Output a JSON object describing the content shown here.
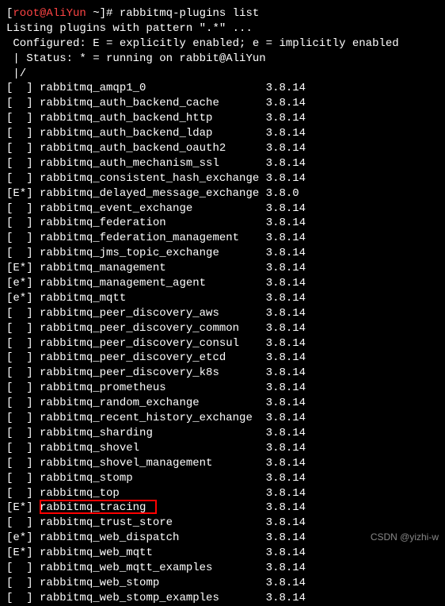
{
  "prompt": {
    "user_host": "root@AliYun",
    "path": "~",
    "command": "rabbitmq-plugins list"
  },
  "header": {
    "line1": "Listing plugins with pattern \".*\" ...",
    "line2": " Configured: E = explicitly enabled; e = implicitly enabled",
    "line3": " | Status: * = running on rabbit@AliYun",
    "line4": " |/"
  },
  "plugins": [
    {
      "flags": "[  ]",
      "name": "rabbitmq_amqp1_0",
      "version": "3.8.14",
      "highlighted": false
    },
    {
      "flags": "[  ]",
      "name": "rabbitmq_auth_backend_cache",
      "version": "3.8.14",
      "highlighted": false
    },
    {
      "flags": "[  ]",
      "name": "rabbitmq_auth_backend_http",
      "version": "3.8.14",
      "highlighted": false
    },
    {
      "flags": "[  ]",
      "name": "rabbitmq_auth_backend_ldap",
      "version": "3.8.14",
      "highlighted": false
    },
    {
      "flags": "[  ]",
      "name": "rabbitmq_auth_backend_oauth2",
      "version": "3.8.14",
      "highlighted": false
    },
    {
      "flags": "[  ]",
      "name": "rabbitmq_auth_mechanism_ssl",
      "version": "3.8.14",
      "highlighted": false
    },
    {
      "flags": "[  ]",
      "name": "rabbitmq_consistent_hash_exchange",
      "version": "3.8.14",
      "highlighted": false
    },
    {
      "flags": "[E*]",
      "name": "rabbitmq_delayed_message_exchange",
      "version": "3.8.0",
      "highlighted": false
    },
    {
      "flags": "[  ]",
      "name": "rabbitmq_event_exchange",
      "version": "3.8.14",
      "highlighted": false
    },
    {
      "flags": "[  ]",
      "name": "rabbitmq_federation",
      "version": "3.8.14",
      "highlighted": false
    },
    {
      "flags": "[  ]",
      "name": "rabbitmq_federation_management",
      "version": "3.8.14",
      "highlighted": false
    },
    {
      "flags": "[  ]",
      "name": "rabbitmq_jms_topic_exchange",
      "version": "3.8.14",
      "highlighted": false
    },
    {
      "flags": "[E*]",
      "name": "rabbitmq_management",
      "version": "3.8.14",
      "highlighted": false
    },
    {
      "flags": "[e*]",
      "name": "rabbitmq_management_agent",
      "version": "3.8.14",
      "highlighted": false
    },
    {
      "flags": "[e*]",
      "name": "rabbitmq_mqtt",
      "version": "3.8.14",
      "highlighted": false
    },
    {
      "flags": "[  ]",
      "name": "rabbitmq_peer_discovery_aws",
      "version": "3.8.14",
      "highlighted": false
    },
    {
      "flags": "[  ]",
      "name": "rabbitmq_peer_discovery_common",
      "version": "3.8.14",
      "highlighted": false
    },
    {
      "flags": "[  ]",
      "name": "rabbitmq_peer_discovery_consul",
      "version": "3.8.14",
      "highlighted": false
    },
    {
      "flags": "[  ]",
      "name": "rabbitmq_peer_discovery_etcd",
      "version": "3.8.14",
      "highlighted": false
    },
    {
      "flags": "[  ]",
      "name": "rabbitmq_peer_discovery_k8s",
      "version": "3.8.14",
      "highlighted": false
    },
    {
      "flags": "[  ]",
      "name": "rabbitmq_prometheus",
      "version": "3.8.14",
      "highlighted": false
    },
    {
      "flags": "[  ]",
      "name": "rabbitmq_random_exchange",
      "version": "3.8.14",
      "highlighted": false
    },
    {
      "flags": "[  ]",
      "name": "rabbitmq_recent_history_exchange",
      "version": "3.8.14",
      "highlighted": false
    },
    {
      "flags": "[  ]",
      "name": "rabbitmq_sharding",
      "version": "3.8.14",
      "highlighted": false
    },
    {
      "flags": "[  ]",
      "name": "rabbitmq_shovel",
      "version": "3.8.14",
      "highlighted": false
    },
    {
      "flags": "[  ]",
      "name": "rabbitmq_shovel_management",
      "version": "3.8.14",
      "highlighted": false
    },
    {
      "flags": "[  ]",
      "name": "rabbitmq_stomp",
      "version": "3.8.14",
      "highlighted": false
    },
    {
      "flags": "[  ]",
      "name": "rabbitmq_top",
      "version": "3.8.14",
      "highlighted": false
    },
    {
      "flags": "[E*]",
      "name": "rabbitmq_tracing",
      "version": "3.8.14",
      "highlighted": true
    },
    {
      "flags": "[  ]",
      "name": "rabbitmq_trust_store",
      "version": "3.8.14",
      "highlighted": false
    },
    {
      "flags": "[e*]",
      "name": "rabbitmq_web_dispatch",
      "version": "3.8.14",
      "highlighted": false
    },
    {
      "flags": "[E*]",
      "name": "rabbitmq_web_mqtt",
      "version": "3.8.14",
      "highlighted": false
    },
    {
      "flags": "[  ]",
      "name": "rabbitmq_web_mqtt_examples",
      "version": "3.8.14",
      "highlighted": false
    },
    {
      "flags": "[  ]",
      "name": "rabbitmq_web_stomp",
      "version": "3.8.14",
      "highlighted": false
    },
    {
      "flags": "[  ]",
      "name": "rabbitmq_web_stomp_examples",
      "version": "3.8.14",
      "highlighted": false
    }
  ],
  "watermark": "CSDN @yizhi-w"
}
